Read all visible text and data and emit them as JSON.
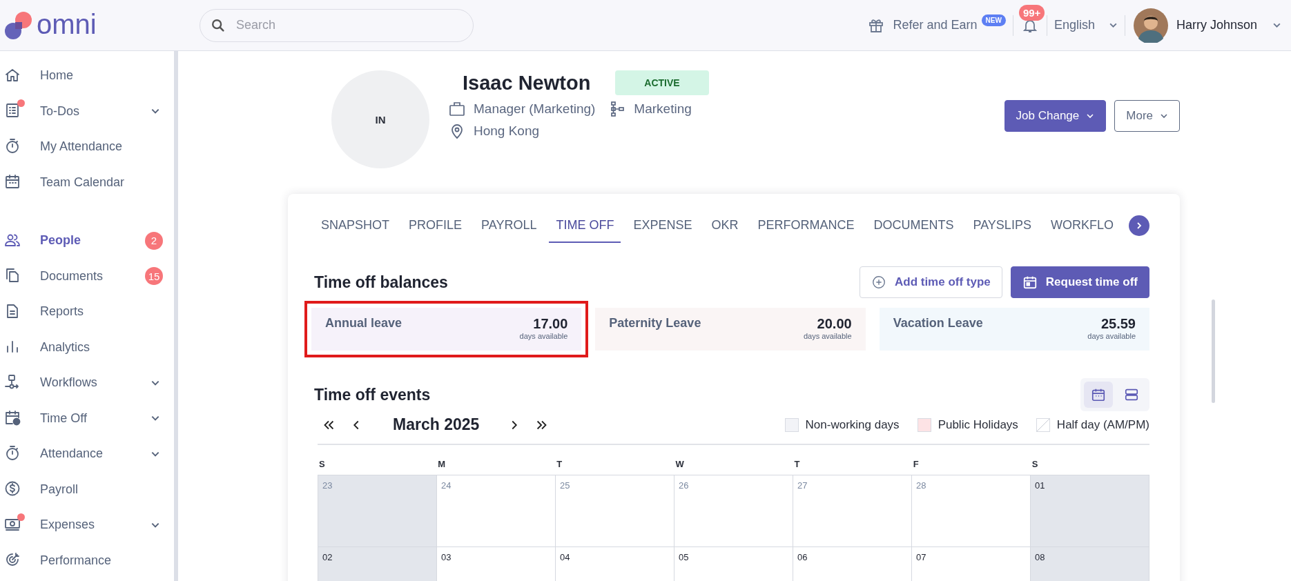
{
  "topbar": {
    "logo": "omni",
    "search": {
      "placeholder": "Search"
    },
    "refer": {
      "label": "Refer and Earn",
      "badge": "NEW"
    },
    "notifications": {
      "count": "99+"
    },
    "language": "English",
    "user": {
      "name": "Harry Johnson"
    }
  },
  "sidebar": {
    "sections": [
      {
        "items": [
          {
            "label": "Home",
            "selected": false
          },
          {
            "label": "To-Dos",
            "selected": false,
            "dot": true,
            "expanded": false
          },
          {
            "label": "My Attendance",
            "selected": false
          },
          {
            "label": "Team Calendar",
            "selected": false
          }
        ]
      },
      {
        "items": [
          {
            "label": "People",
            "selected": true,
            "badge": "2"
          },
          {
            "label": "Documents",
            "selected": false,
            "badge": "15"
          },
          {
            "label": "Reports",
            "selected": false
          },
          {
            "label": "Analytics",
            "selected": false
          },
          {
            "label": "Workflows",
            "selected": false,
            "expanded": false
          },
          {
            "label": "Time Off",
            "selected": false,
            "expanded": false
          },
          {
            "label": "Attendance",
            "selected": false,
            "expanded": false
          },
          {
            "label": "Payroll",
            "selected": false
          },
          {
            "label": "Expenses",
            "selected": false,
            "dot": true,
            "expanded": false
          },
          {
            "label": "Performance",
            "selected": false
          }
        ]
      }
    ]
  },
  "profile": {
    "initials": "IN",
    "name": "Isaac Newton",
    "status": "ACTIVE",
    "position": "Manager (Marketing)",
    "department": "Marketing",
    "location": "Hong Kong",
    "buttons": [
      {
        "label": "Job Change",
        "kind": "primary"
      },
      {
        "label": "More",
        "kind": "outline"
      }
    ]
  },
  "tabs": [
    {
      "label": "SNAPSHOT",
      "selected": false
    },
    {
      "label": "PROFILE",
      "selected": false
    },
    {
      "label": "PAYROLL",
      "selected": false
    },
    {
      "label": "TIME OFF",
      "selected": true
    },
    {
      "label": "EXPENSE",
      "selected": false
    },
    {
      "label": "OKR",
      "selected": false
    },
    {
      "label": "PERFORMANCE",
      "selected": false
    },
    {
      "label": "DOCUMENTS",
      "selected": false
    },
    {
      "label": "PAYSLIPS",
      "selected": false
    },
    {
      "label": "WORKFLO",
      "selected": false
    }
  ],
  "balances": {
    "title": "Time off balances",
    "buttons": [
      {
        "label": "Add time off type",
        "kind": "outline"
      },
      {
        "label": "Request time off",
        "kind": "primary"
      }
    ],
    "items": [
      {
        "name": "Annual leave",
        "value": "17.00",
        "unit": "days available",
        "color": "#f6f2fa",
        "highlighted": true
      },
      {
        "name": "Paternity Leave",
        "value": "20.00",
        "unit": "days available",
        "color": "#faf5f5",
        "highlighted": false
      },
      {
        "name": "Vacation Leave",
        "value": "25.59",
        "unit": "days available",
        "color": "#f2f8fc",
        "highlighted": false
      }
    ]
  },
  "events": {
    "title": "Time off events",
    "views": [
      {
        "selected": true
      },
      {
        "selected": false
      }
    ],
    "month": "March 2025",
    "legend": [
      {
        "label": "Non-working days",
        "kind": "fill",
        "color": "#f2f3f7"
      },
      {
        "label": "Public Holidays",
        "kind": "fill",
        "color": "#fde3e5"
      },
      {
        "label": "Half day (AM/PM)",
        "kind": "diagonal",
        "color": "#ffffff"
      }
    ],
    "weekdays": [
      "S",
      "M",
      "T",
      "W",
      "T",
      "F",
      "S"
    ],
    "weeks": [
      [
        {
          "day": "23",
          "other_month": true,
          "non_working": true
        },
        {
          "day": "24",
          "other_month": true,
          "non_working": false
        },
        {
          "day": "25",
          "other_month": true,
          "non_working": false
        },
        {
          "day": "26",
          "other_month": true,
          "non_working": false
        },
        {
          "day": "27",
          "other_month": true,
          "non_working": false
        },
        {
          "day": "28",
          "other_month": true,
          "non_working": false
        },
        {
          "day": "01",
          "other_month": false,
          "non_working": true
        }
      ],
      [
        {
          "day": "02",
          "other_month": false,
          "non_working": true
        },
        {
          "day": "03",
          "other_month": false,
          "non_working": false
        },
        {
          "day": "04",
          "other_month": false,
          "non_working": false
        },
        {
          "day": "05",
          "other_month": false,
          "non_working": false
        },
        {
          "day": "06",
          "other_month": false,
          "non_working": false
        },
        {
          "day": "07",
          "other_month": false,
          "non_working": false
        },
        {
          "day": "08",
          "other_month": false,
          "non_working": true
        }
      ]
    ]
  }
}
